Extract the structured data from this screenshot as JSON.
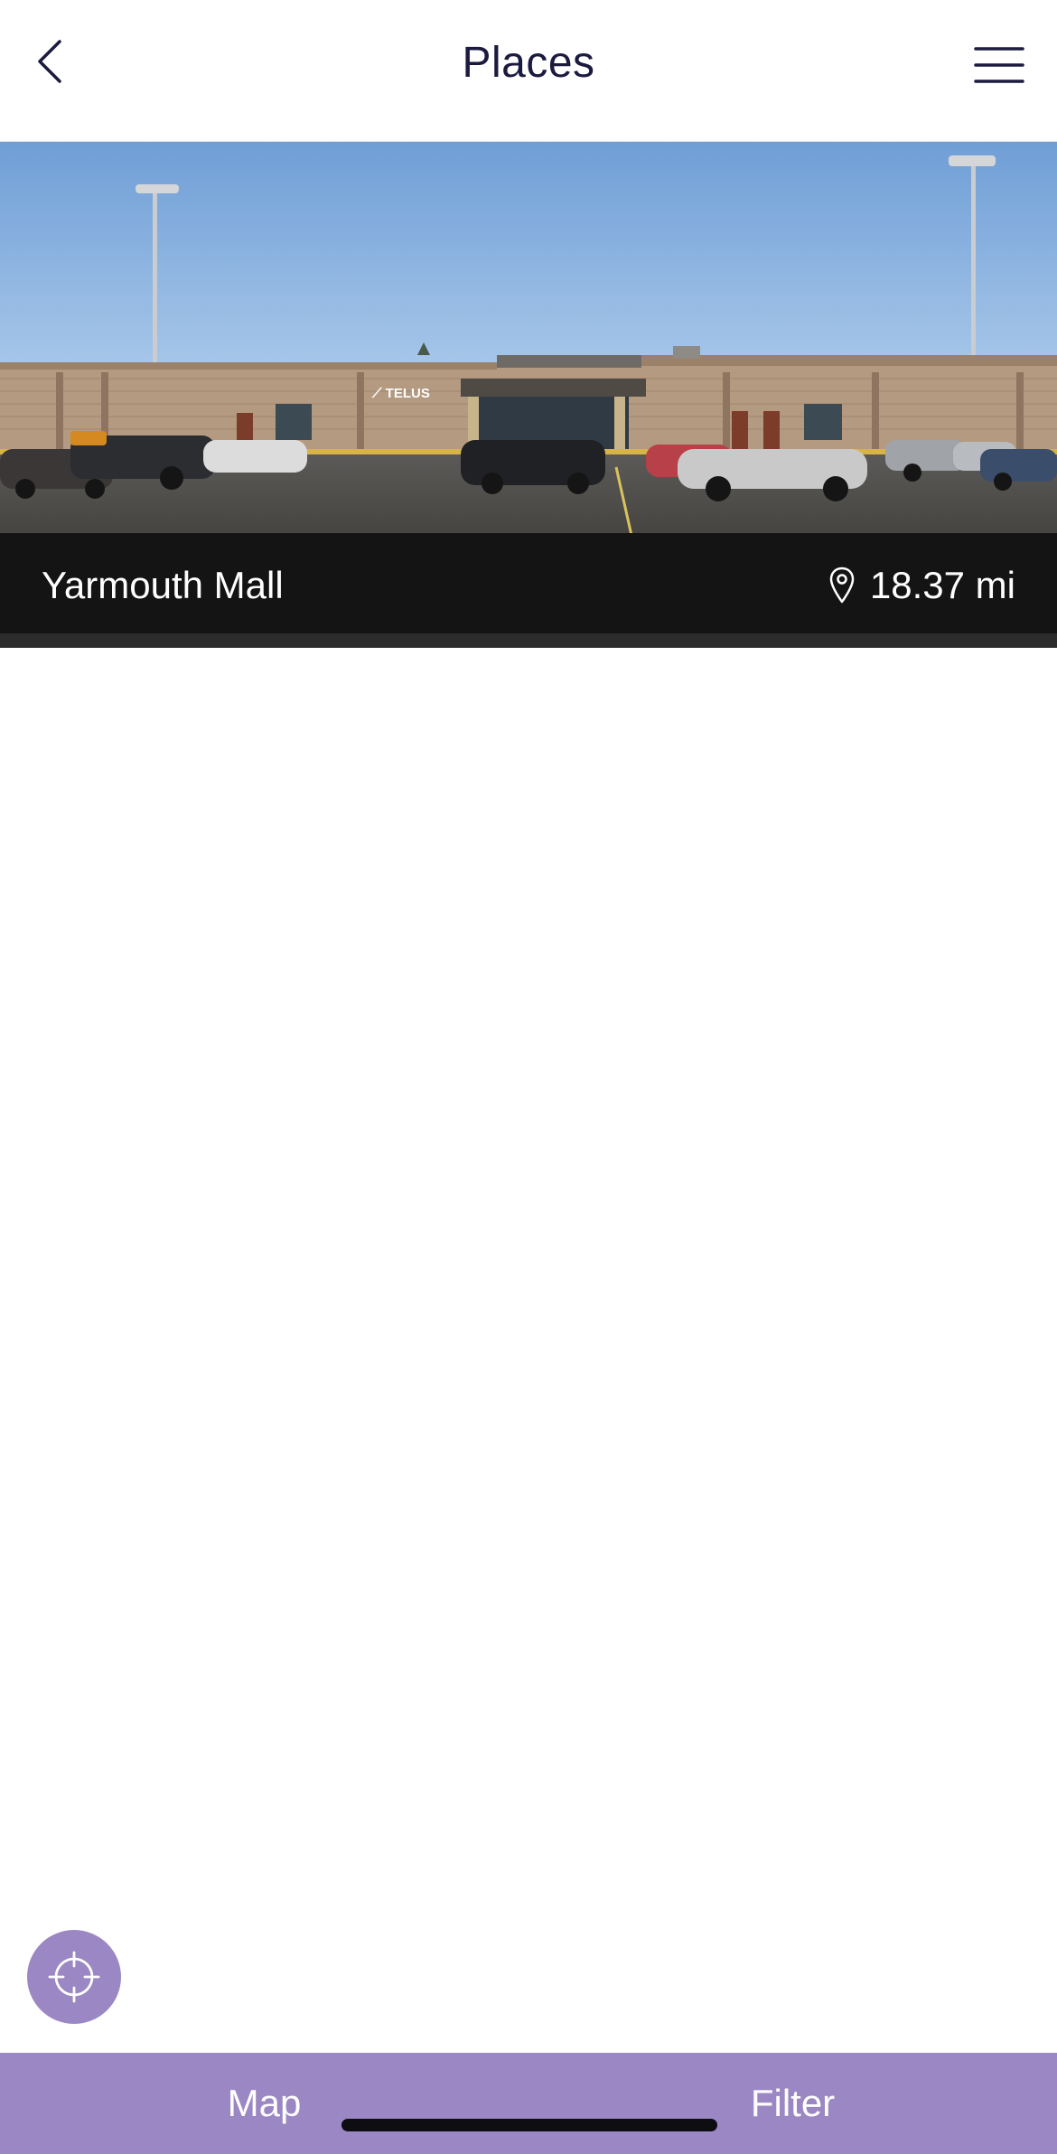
{
  "header": {
    "title": "Places",
    "back_icon": "chevron-left-icon",
    "menu_icon": "hamburger-menu-icon"
  },
  "places": [
    {
      "name": "Yarmouth Mall",
      "distance": "18.37 mi",
      "distance_icon": "location-pin-icon",
      "image_sign_text": "TELUS"
    }
  ],
  "locate_button": {
    "icon": "crosshair-icon"
  },
  "bottom_bar": {
    "map_label": "Map",
    "filter_label": "Filter"
  },
  "colors": {
    "accent": "#9b87c3",
    "title_text": "#1b1a3f",
    "caption_bg": "#141414"
  }
}
